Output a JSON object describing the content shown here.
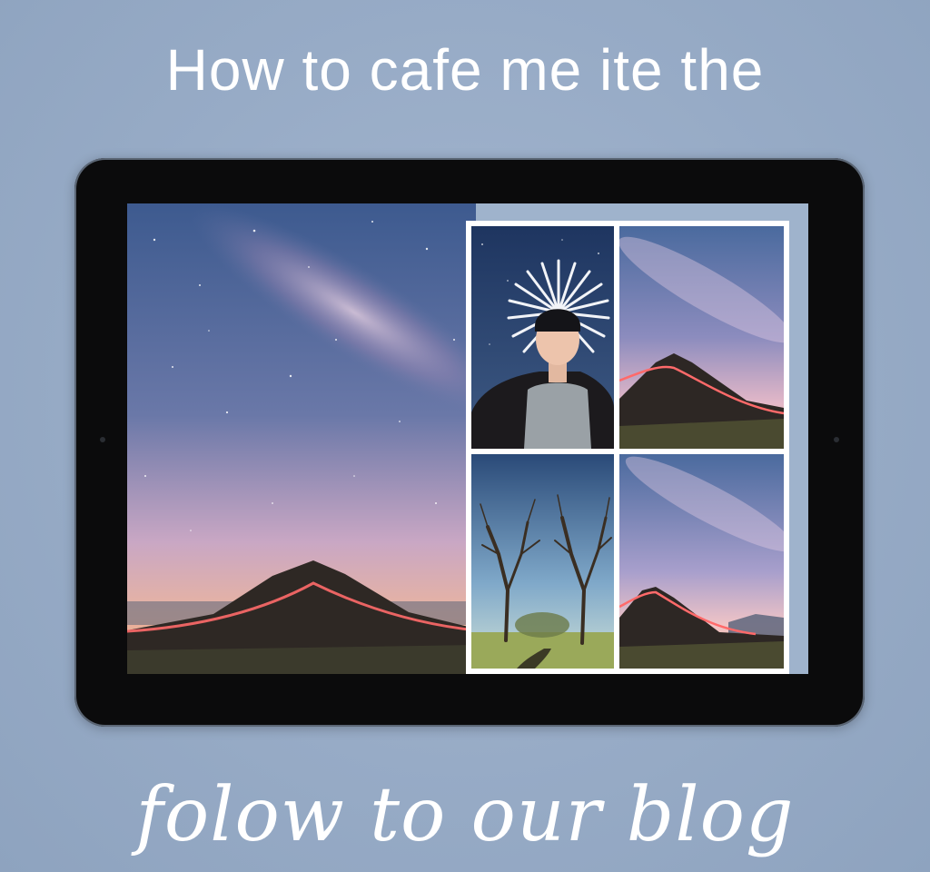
{
  "headline": "How to cafe me ite the",
  "footer": "folow to our blog",
  "colors": {
    "background": "#97abc6",
    "tablet_bezel": "#0b0b0c",
    "text": "#ffffff",
    "light_trail": "#ff6a6a"
  },
  "tablet": {
    "main_photo": "milky-way-mountain-photo",
    "collage": [
      "portrait-with-halo-photo",
      "milky-way-mountain-photo",
      "bare-trees-photo",
      "milky-way-mountain-photo"
    ]
  }
}
